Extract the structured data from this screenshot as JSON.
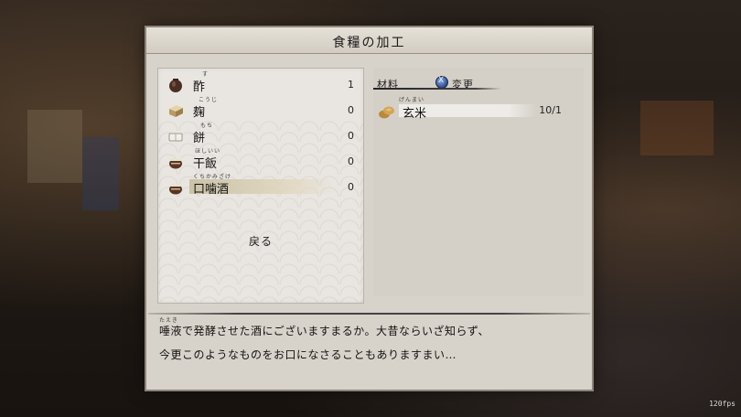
{
  "window": {
    "title": "食糧の加工"
  },
  "items": [
    {
      "ruby": "す",
      "name": "酢",
      "count": "1",
      "icon": "pot-icon"
    },
    {
      "ruby": "こうじ",
      "name": "麹",
      "count": "0",
      "icon": "koji-block-icon"
    },
    {
      "ruby": "もち",
      "name": "餅",
      "count": "0",
      "icon": "mochi-icon"
    },
    {
      "ruby": "ほしいい",
      "name": "干飯",
      "count": "0",
      "icon": "dried-rice-pot-icon"
    },
    {
      "ruby": "くちかみざけ",
      "name": "口噛酒",
      "count": "0",
      "icon": "sake-pot-icon"
    }
  ],
  "back_label": "戻る",
  "ingredients": {
    "header": "材料",
    "change_label": "変更",
    "change_button_glyph": "X",
    "rows": [
      {
        "ruby": "げんまい",
        "name": "玄米",
        "qty": "10/1",
        "icon": "brown-rice-sacks-icon"
      }
    ]
  },
  "description": {
    "ruby": "たえき",
    "line1": "唾液で発酵させた酒にございますまるか。大昔ならいざ知らず、",
    "line2": "今更このようなものをお口になさることもありますまい…"
  },
  "fps": "120fps"
}
